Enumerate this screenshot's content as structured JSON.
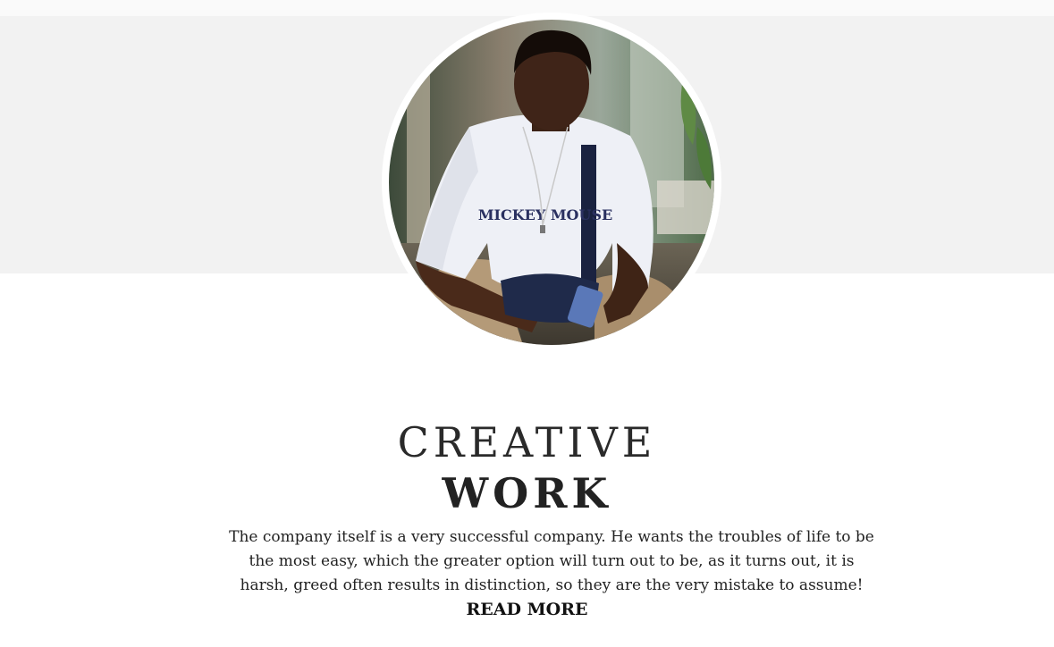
{
  "hero": {
    "band_color": "#f2f2f2",
    "photo_alt": "Profile photo of a young man in a white Mickey Mouse t-shirt",
    "shirt_print": "MICKEY MOUSE"
  },
  "feature": {
    "title_light": "CREATIVE",
    "title_bold": "WORK",
    "description": "The company itself is a very successful company. He wants the troubles of life to be the most easy, which the greater option will turn out to be, as it turns out, it is harsh, greed often results in distinction, so they are the very mistake to assume!",
    "read_more_label": "READ MORE"
  },
  "colors": {
    "text": "#222222",
    "background": "#ffffff"
  }
}
